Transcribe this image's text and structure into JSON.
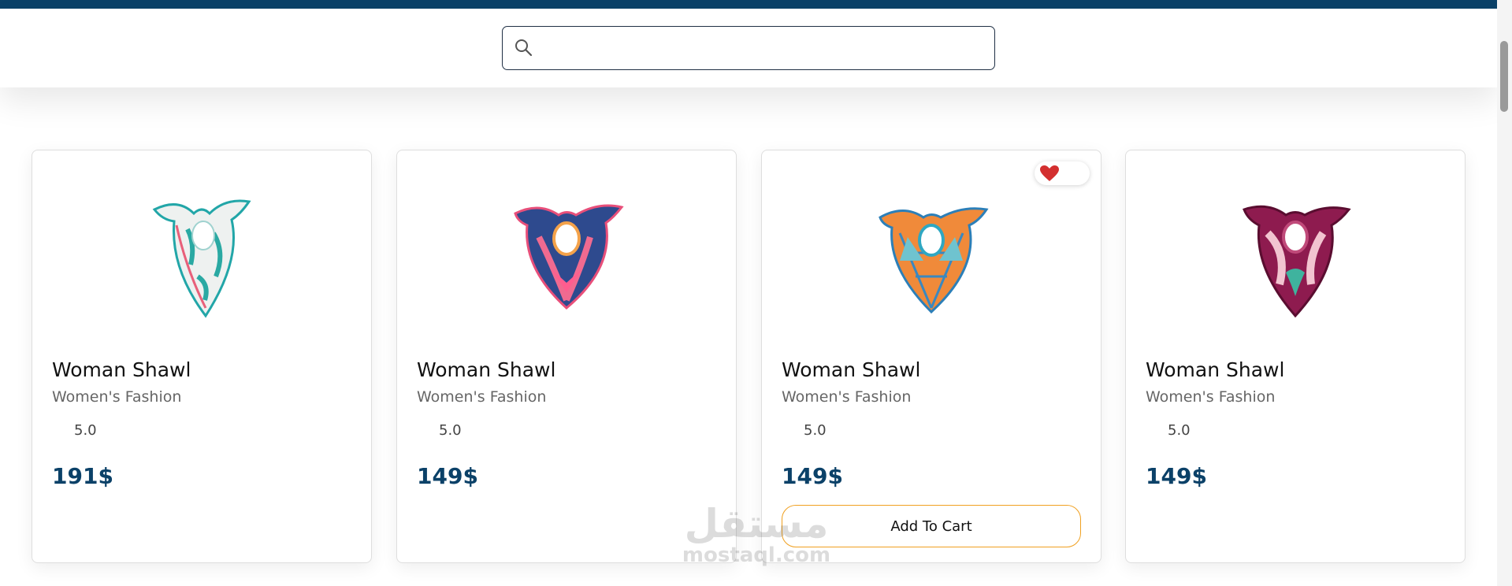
{
  "search": {
    "placeholder": "",
    "value": ""
  },
  "products": [
    {
      "name": "Woman Shawl",
      "category": "Women's Fashion",
      "rating": "5.0",
      "price": "191$",
      "favorite": false,
      "show_cart_button": false
    },
    {
      "name": "Woman Shawl",
      "category": "Women's Fashion",
      "rating": "5.0",
      "price": "149$",
      "favorite": false,
      "show_cart_button": false
    },
    {
      "name": "Woman Shawl",
      "category": "Women's Fashion",
      "rating": "5.0",
      "price": "149$",
      "favorite": true,
      "show_cart_button": true
    },
    {
      "name": "Woman Shawl",
      "category": "Women's Fashion",
      "rating": "5.0",
      "price": "149$",
      "favorite": false,
      "show_cart_button": false
    }
  ],
  "cart_button_label": "Add To Cart",
  "watermark": {
    "arabic": "مستقل",
    "latin": "mostaql.com"
  },
  "colors": {
    "brand_navy": "#0b4168",
    "accent_orange": "#f0a020",
    "heart_red": "#d32f2f"
  },
  "icons": [
    "search-icon",
    "heart-icon",
    "scarf-image"
  ]
}
